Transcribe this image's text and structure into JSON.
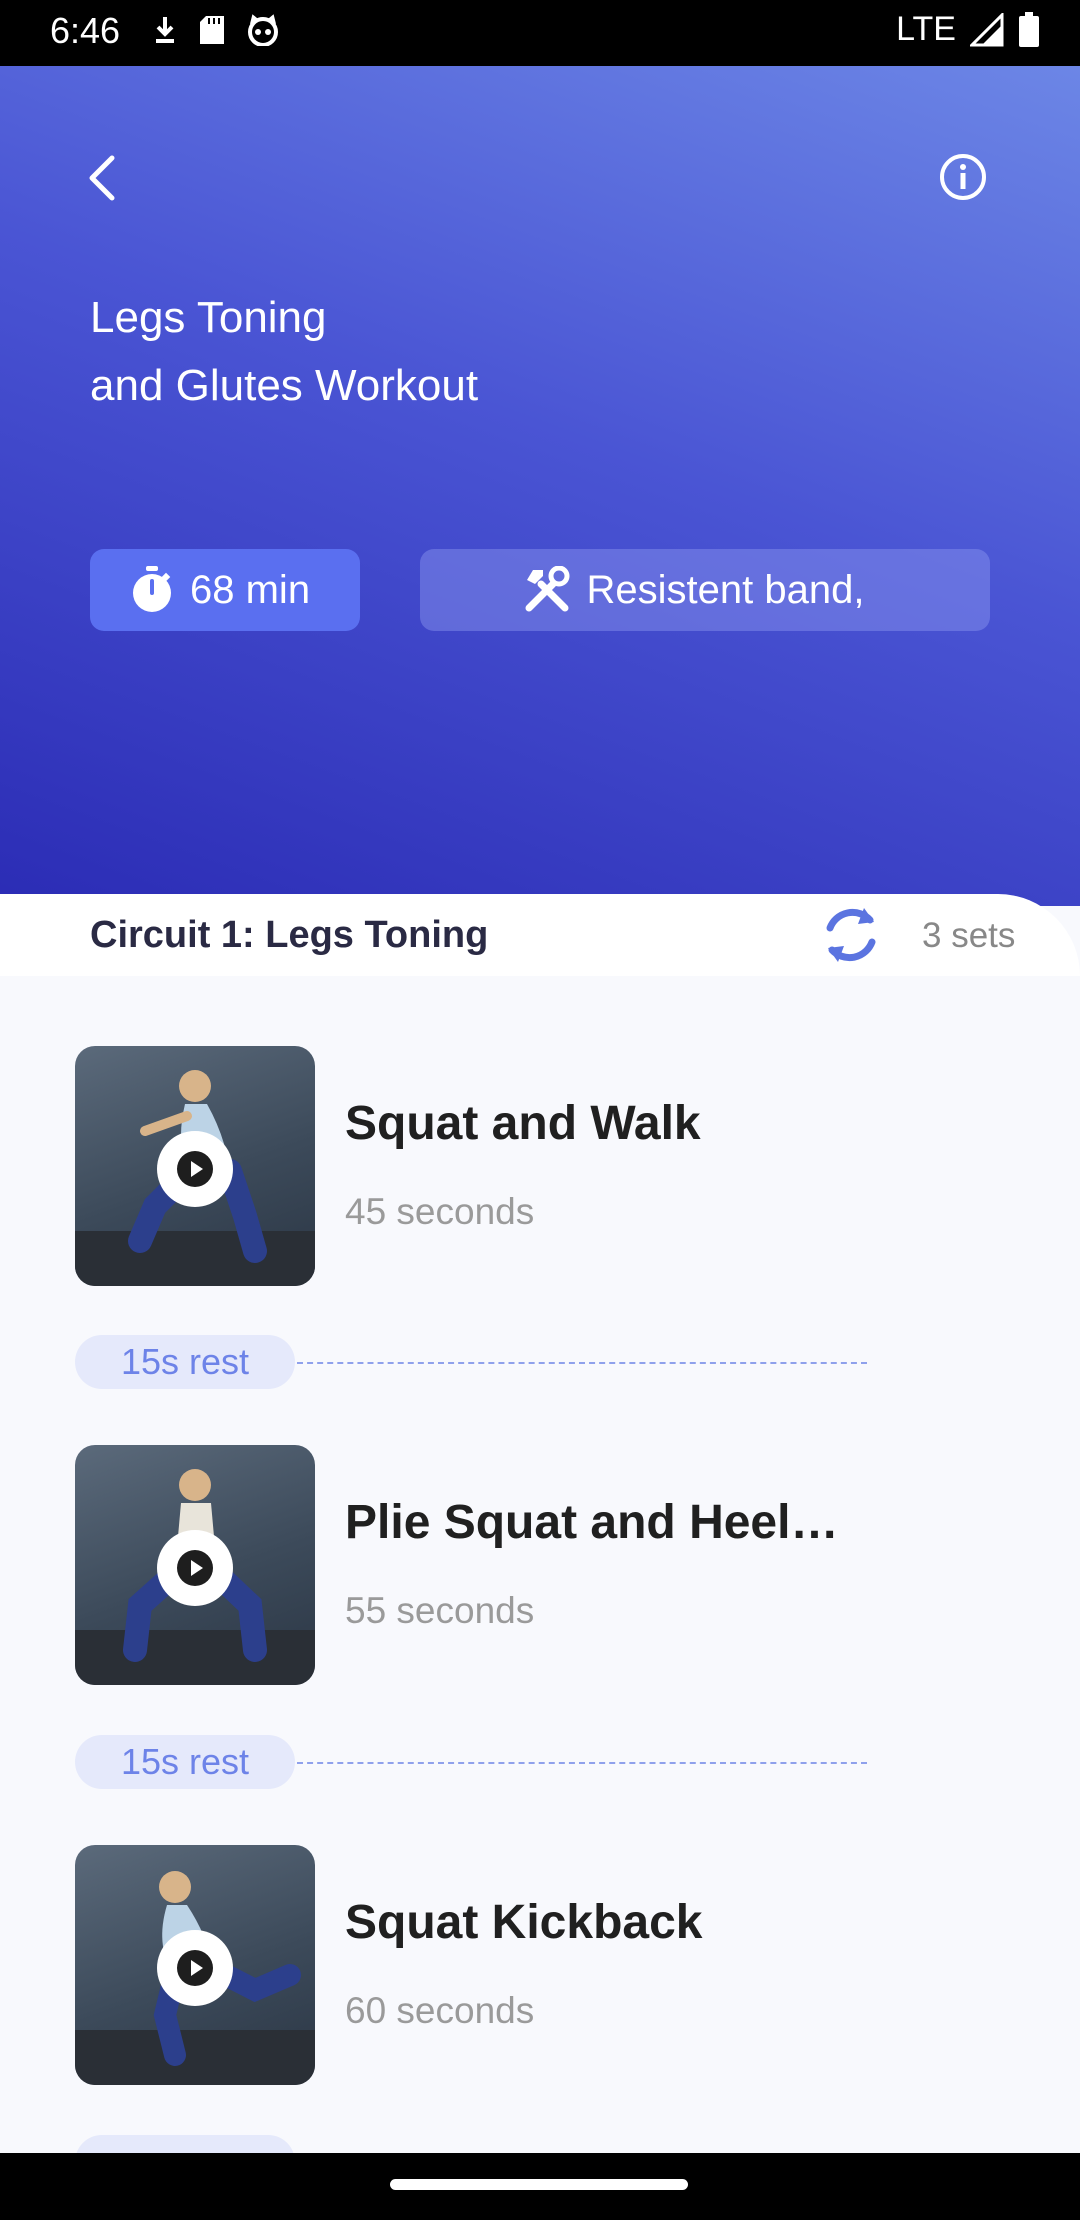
{
  "status_bar": {
    "time": "6:46",
    "network": "LTE",
    "icons": [
      "download-icon",
      "sd-card-icon",
      "cat-face-icon",
      "signal-icon",
      "battery-icon"
    ]
  },
  "header": {
    "title_line1": "Legs Toning",
    "title_line2": "and Glutes Workout",
    "duration": "68 min",
    "equipment": "Resistent band,",
    "icons": [
      "back-arrow-icon",
      "info-icon",
      "stopwatch-icon",
      "tools-icon"
    ]
  },
  "circuit": {
    "title": "Circuit 1: Legs Toning",
    "sets": "3 sets",
    "icon": "repeat-icon"
  },
  "exercises": [
    {
      "name": "Squat and Walk",
      "duration": "45 seconds"
    },
    {
      "name": "Plie Squat and Heel…",
      "duration": "55 seconds"
    },
    {
      "name": "Squat Kickback",
      "duration": "60 seconds"
    }
  ],
  "rests": [
    "15s rest",
    "15s rest"
  ],
  "colors": {
    "hero_gradient": [
      "#6c86e6",
      "#2b2cb5"
    ],
    "accent": "#5a6ff0",
    "rest_text": "#6d83e8",
    "repeat_icon": "#5b74e0"
  }
}
